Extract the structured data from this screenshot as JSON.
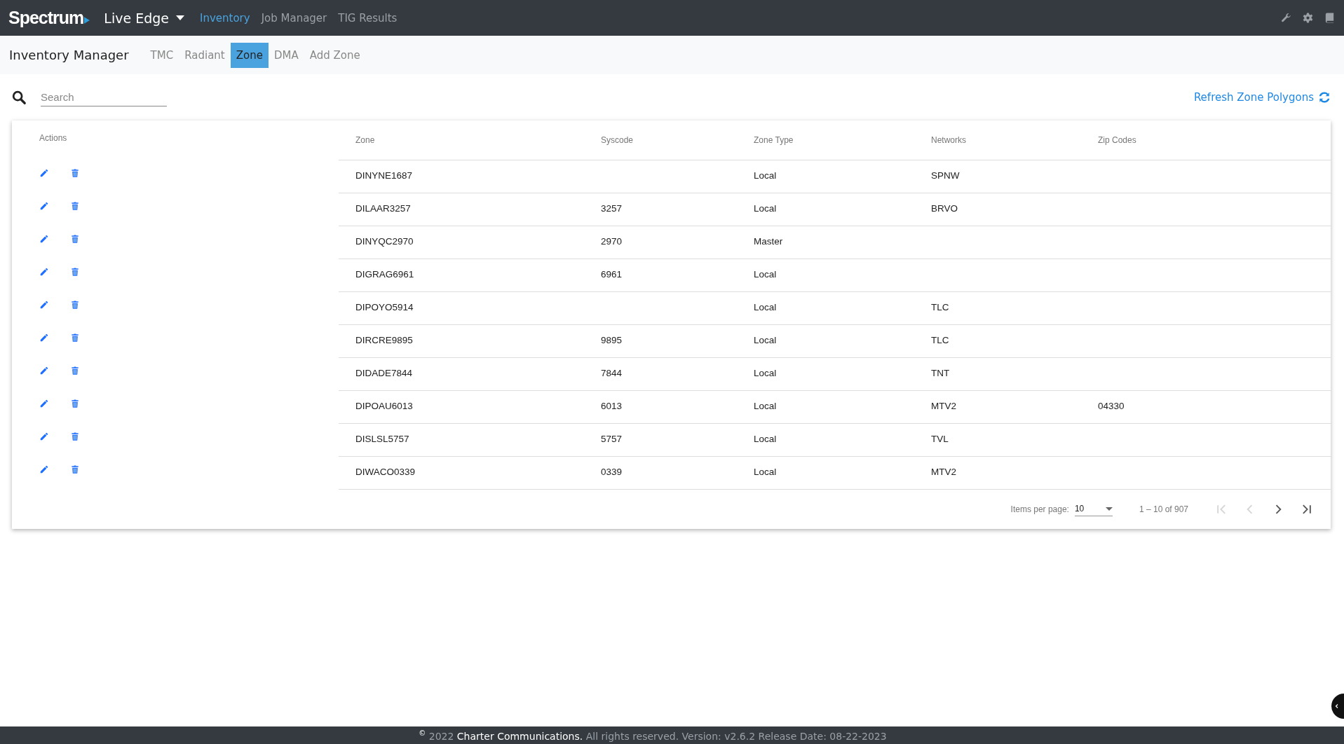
{
  "topbar": {
    "logo": "Spectrum",
    "app_menu": "Live Edge",
    "nav": [
      {
        "label": "Inventory",
        "selected": true
      },
      {
        "label": "Job Manager",
        "selected": false
      },
      {
        "label": "TIG Results",
        "selected": false
      }
    ]
  },
  "subnav": {
    "title": "Inventory Manager",
    "tabs": [
      {
        "label": "TMC",
        "selected": false
      },
      {
        "label": "Radiant",
        "selected": false
      },
      {
        "label": "Zone",
        "selected": true
      },
      {
        "label": "DMA",
        "selected": false
      },
      {
        "label": "Add Zone",
        "selected": false
      }
    ]
  },
  "search": {
    "placeholder": "Search"
  },
  "refresh_link": "Refresh Zone Polygons",
  "table": {
    "actions_header": "Actions",
    "columns": [
      "Zone",
      "Syscode",
      "Zone Type",
      "Networks",
      "Zip Codes"
    ],
    "rows": [
      [
        "DINYNE1687",
        "",
        "Local",
        "SPNW",
        ""
      ],
      [
        "DILAAR3257",
        "3257",
        "Local",
        "BRVO",
        ""
      ],
      [
        "DINYQC2970",
        "2970",
        "Master",
        "",
        ""
      ],
      [
        "DIGRAG6961",
        "6961",
        "Local",
        "",
        ""
      ],
      [
        "DIPOYO5914",
        "",
        "Local",
        "TLC",
        ""
      ],
      [
        "DIRCRE9895",
        "9895",
        "Local",
        "TLC",
        ""
      ],
      [
        "DIDADE7844",
        "7844",
        "Local",
        "TNT",
        ""
      ],
      [
        "DIPOAU6013",
        "6013",
        "Local",
        "MTV2",
        "04330"
      ],
      [
        "DISLSL5757",
        "5757",
        "Local",
        "TVL",
        ""
      ],
      [
        "DIWACO0339",
        "0339",
        "Local",
        "MTV2",
        ""
      ]
    ]
  },
  "paginator": {
    "items_label": "Items per page:",
    "page_size": "10",
    "range": "1 – 10 of 907",
    "buttons": [
      {
        "kind": "first",
        "disabled": true
      },
      {
        "kind": "prev",
        "disabled": true
      },
      {
        "kind": "next",
        "disabled": false
      },
      {
        "kind": "last",
        "disabled": false
      }
    ]
  },
  "footer": {
    "copyright": "©",
    "year": "2022",
    "company": "Charter Communications.",
    "rest": "All rights reserved. Version: v2.6.2 Release Date: 08-22-2023"
  }
}
